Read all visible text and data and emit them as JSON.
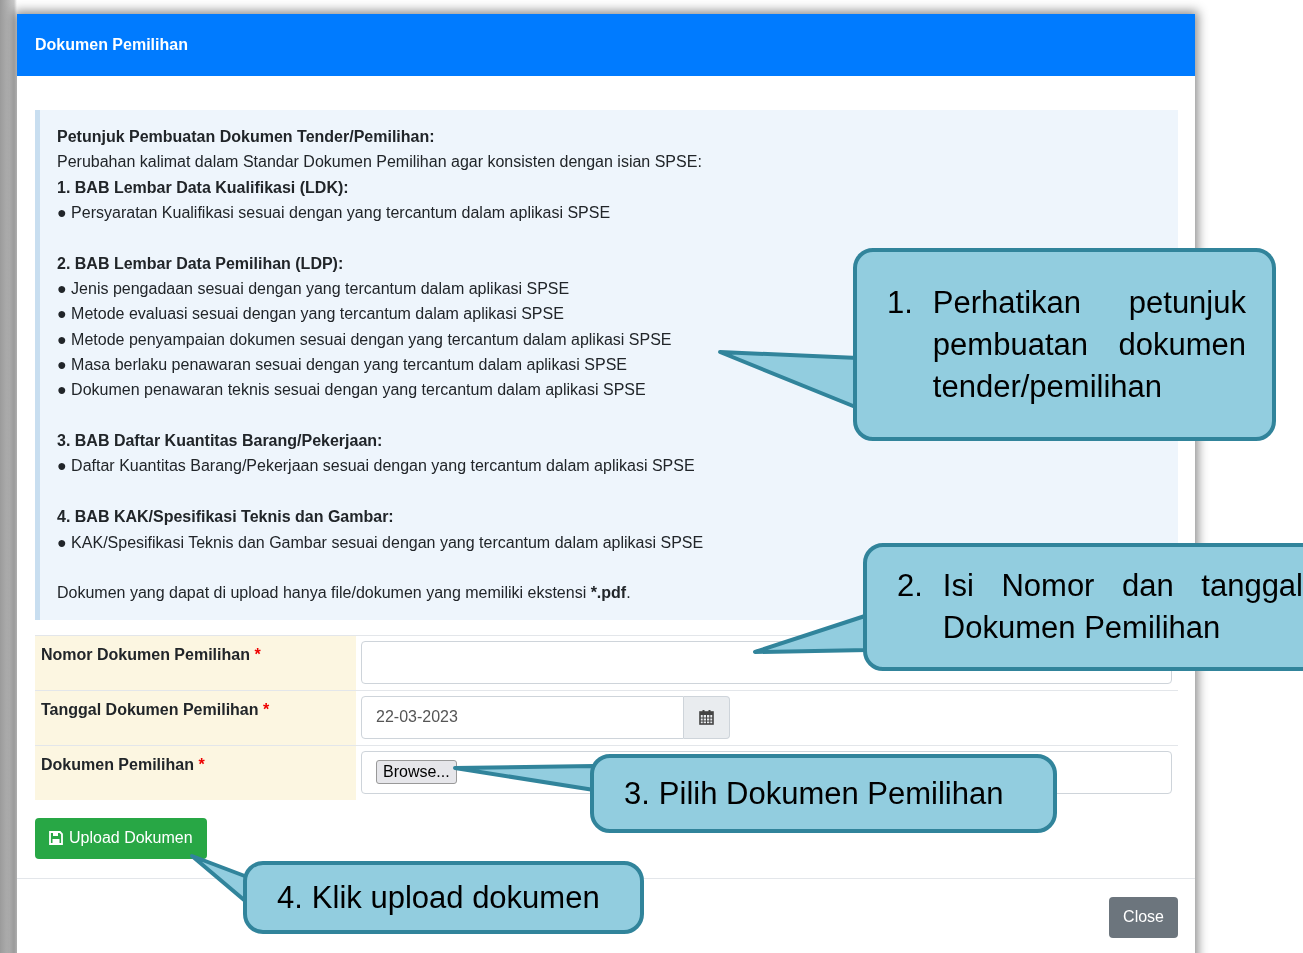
{
  "dialog": {
    "title": "Dokumen Pemilihan"
  },
  "instructions": {
    "title": "Petunjuk Pembuatan Dokumen Tender/Pemilihan:",
    "intro": "Perubahan kalimat dalam Standar Dokumen Pemilihan agar konsisten dengan isian SPSE:",
    "sections": [
      {
        "heading": "1. BAB Lembar Data Kualifikasi (LDK):",
        "bullets": [
          "● Persyaratan Kualifikasi sesuai dengan yang tercantum dalam aplikasi SPSE"
        ]
      },
      {
        "heading": "2. BAB Lembar Data Pemilihan (LDP):",
        "bullets": [
          "● Jenis pengadaan sesuai dengan yang tercantum dalam aplikasi SPSE",
          "● Metode evaluasi sesuai dengan yang tercantum dalam aplikasi SPSE",
          "● Metode penyampaian dokumen sesuai dengan yang tercantum dalam aplikasi SPSE",
          "● Masa berlaku penawaran sesuai dengan yang tercantum dalam aplikasi SPSE",
          "● Dokumen penawaran teknis sesuai dengan yang tercantum dalam aplikasi SPSE"
        ]
      },
      {
        "heading": "3. BAB Daftar Kuantitas Barang/Pekerjaan:",
        "bullets": [
          "● Daftar Kuantitas Barang/Pekerjaan sesuai dengan yang tercantum dalam aplikasi SPSE"
        ]
      },
      {
        "heading": "4. BAB KAK/Spesifikasi Teknis dan Gambar:",
        "bullets": [
          "● KAK/Spesifikasi Teknis dan Gambar sesuai dengan yang tercantum dalam aplikasi SPSE"
        ]
      }
    ],
    "note": {
      "text": "Dokumen yang dapat di upload hanya file/dokumen yang memiliki ekstensi ",
      "emphasis": "*.pdf",
      "end": "."
    }
  },
  "fields": [
    {
      "kind": "text",
      "label": "Nomor Dokumen Pemilihan",
      "required_mark": "*"
    },
    {
      "kind": "date",
      "label": "Tanggal Dokumen Pemilihan",
      "required_mark": "*",
      "value": "22-03-2023"
    },
    {
      "kind": "file",
      "label": "Dokumen Pemilihan",
      "required_mark": "*",
      "button": "Browse..."
    }
  ],
  "upload_button": "Upload Dokumen",
  "close_button": "Close",
  "callouts": [
    {
      "number": "1.",
      "text": "Perhatikan petunjuk pembuatan dokumen tender/pemilihan"
    },
    {
      "number": "2.",
      "text": "Isi Nomor dan tanggal Dokumen Pemilihan"
    },
    {
      "number": "3.",
      "text": "Pilih Dokumen Pemilihan"
    },
    {
      "number": "4.",
      "text": "Klik upload dokumen"
    }
  ]
}
